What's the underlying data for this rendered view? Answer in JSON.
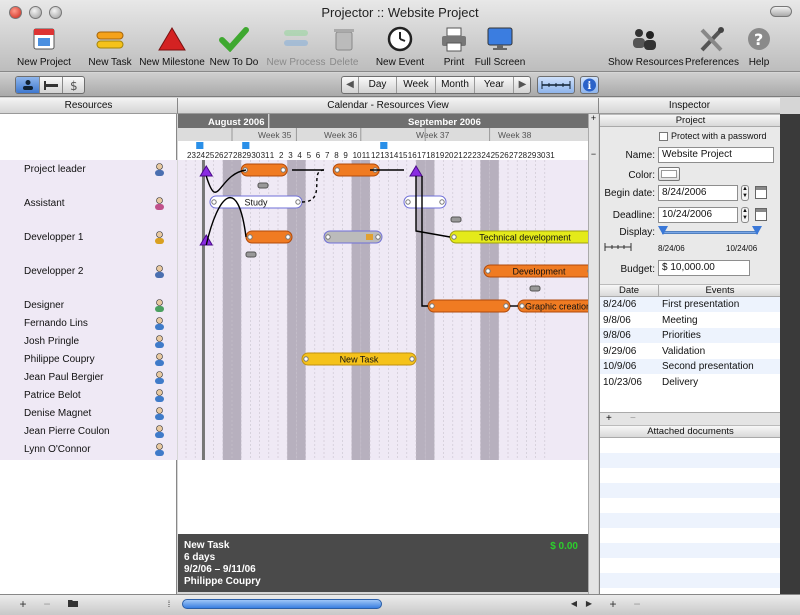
{
  "window": {
    "title": "Projector :: Website Project"
  },
  "toolbar": [
    {
      "id": "new-project",
      "label": "New Project",
      "icon": "calendar-icon",
      "enabled": true
    },
    {
      "id": "new-task",
      "label": "New Task",
      "icon": "task-bar-icon",
      "enabled": true
    },
    {
      "id": "new-milestone",
      "label": "New Milestone",
      "icon": "milestone-triangle-icon",
      "enabled": true
    },
    {
      "id": "new-todo",
      "label": "New To Do",
      "icon": "checkmark-icon",
      "enabled": true
    },
    {
      "id": "new-process",
      "label": "New Process",
      "icon": "process-icon",
      "enabled": false
    },
    {
      "id": "delete",
      "label": "Delete",
      "icon": "trash-icon",
      "enabled": false
    },
    {
      "id": "new-event",
      "label": "New Event",
      "icon": "clock-icon",
      "enabled": true
    },
    {
      "id": "print",
      "label": "Print",
      "icon": "printer-icon",
      "enabled": true
    },
    {
      "id": "full-screen",
      "label": "Full Screen",
      "icon": "monitor-icon",
      "enabled": true
    },
    {
      "id": "show-resources",
      "label": "Show Resources",
      "icon": "resources-icon",
      "enabled": true
    },
    {
      "id": "preferences",
      "label": "Preferences",
      "icon": "tools-icon",
      "enabled": true
    },
    {
      "id": "help",
      "label": "Help",
      "icon": "help-icon",
      "enabled": true
    }
  ],
  "viewbar": {
    "scale": [
      "Day",
      "Week",
      "Month",
      "Year"
    ],
    "selected_scale": "Week"
  },
  "panels": {
    "resources": "Resources",
    "calendar": "Calendar - Resources View",
    "inspector": "Inspector"
  },
  "calendar": {
    "months": [
      "August 2006",
      "September 2006"
    ],
    "weeks": [
      "Week 35",
      "Week 36",
      "Week 37",
      "Week 38"
    ],
    "days": [
      "23",
      "24",
      "25",
      "26",
      "27",
      "28",
      "29",
      "30",
      "31",
      "1",
      "2",
      "3",
      "4",
      "5",
      "6",
      "7",
      "8",
      "9",
      "10",
      "11",
      "12",
      "13",
      "14",
      "15",
      "16",
      "17",
      "18",
      "19",
      "20",
      "21",
      "22",
      "23",
      "24",
      "25",
      "26",
      "27",
      "28",
      "29",
      "30",
      "31"
    ]
  },
  "resources": [
    "Project leader",
    "Assistant",
    "Developper 1",
    "Developper 2",
    "Designer",
    "Fernando Lins",
    "Josh Pringle",
    "Philippe Coupry",
    "Jean Paul Bergier",
    "Patrice Belot",
    "Denise Magnet",
    "Jean Pierre Coulon",
    "Lynn O'Connor"
  ],
  "tasks": [
    {
      "label": "Study"
    },
    {
      "label": "Technical development"
    },
    {
      "label": "Development"
    },
    {
      "label": "Graphic creation"
    },
    {
      "label": "New Task"
    }
  ],
  "info": {
    "name": "New Task",
    "duration": "6 days",
    "dates": "9/2/06 – 9/11/06",
    "resource": "Philippe Coupry",
    "cost": "$ 0.00"
  },
  "inspector": {
    "section": "Project",
    "protect_label": "Protect with a password",
    "name_label": "Name:",
    "name_value": "Website Project",
    "color_label": "Color:",
    "begin_label": "Begin date:",
    "begin_value": "8/24/2006",
    "deadline_label": "Deadline:",
    "deadline_value": "10/24/2006",
    "display_label": "Display:",
    "display_from": "8/24/06",
    "display_to": "10/24/06",
    "budget_label": "Budget:",
    "budget_value": "$ 10,000.00",
    "events_cols": [
      "Date",
      "Events"
    ],
    "events": [
      {
        "date": "8/24/06",
        "event": "First presentation"
      },
      {
        "date": "9/8/06",
        "event": "Meeting"
      },
      {
        "date": "9/8/06",
        "event": "Priorities"
      },
      {
        "date": "9/29/06",
        "event": "Validation"
      },
      {
        "date": "10/9/06",
        "event": "Second presentation"
      },
      {
        "date": "10/23/06",
        "event": "Delivery"
      }
    ],
    "attached": "Attached documents"
  }
}
